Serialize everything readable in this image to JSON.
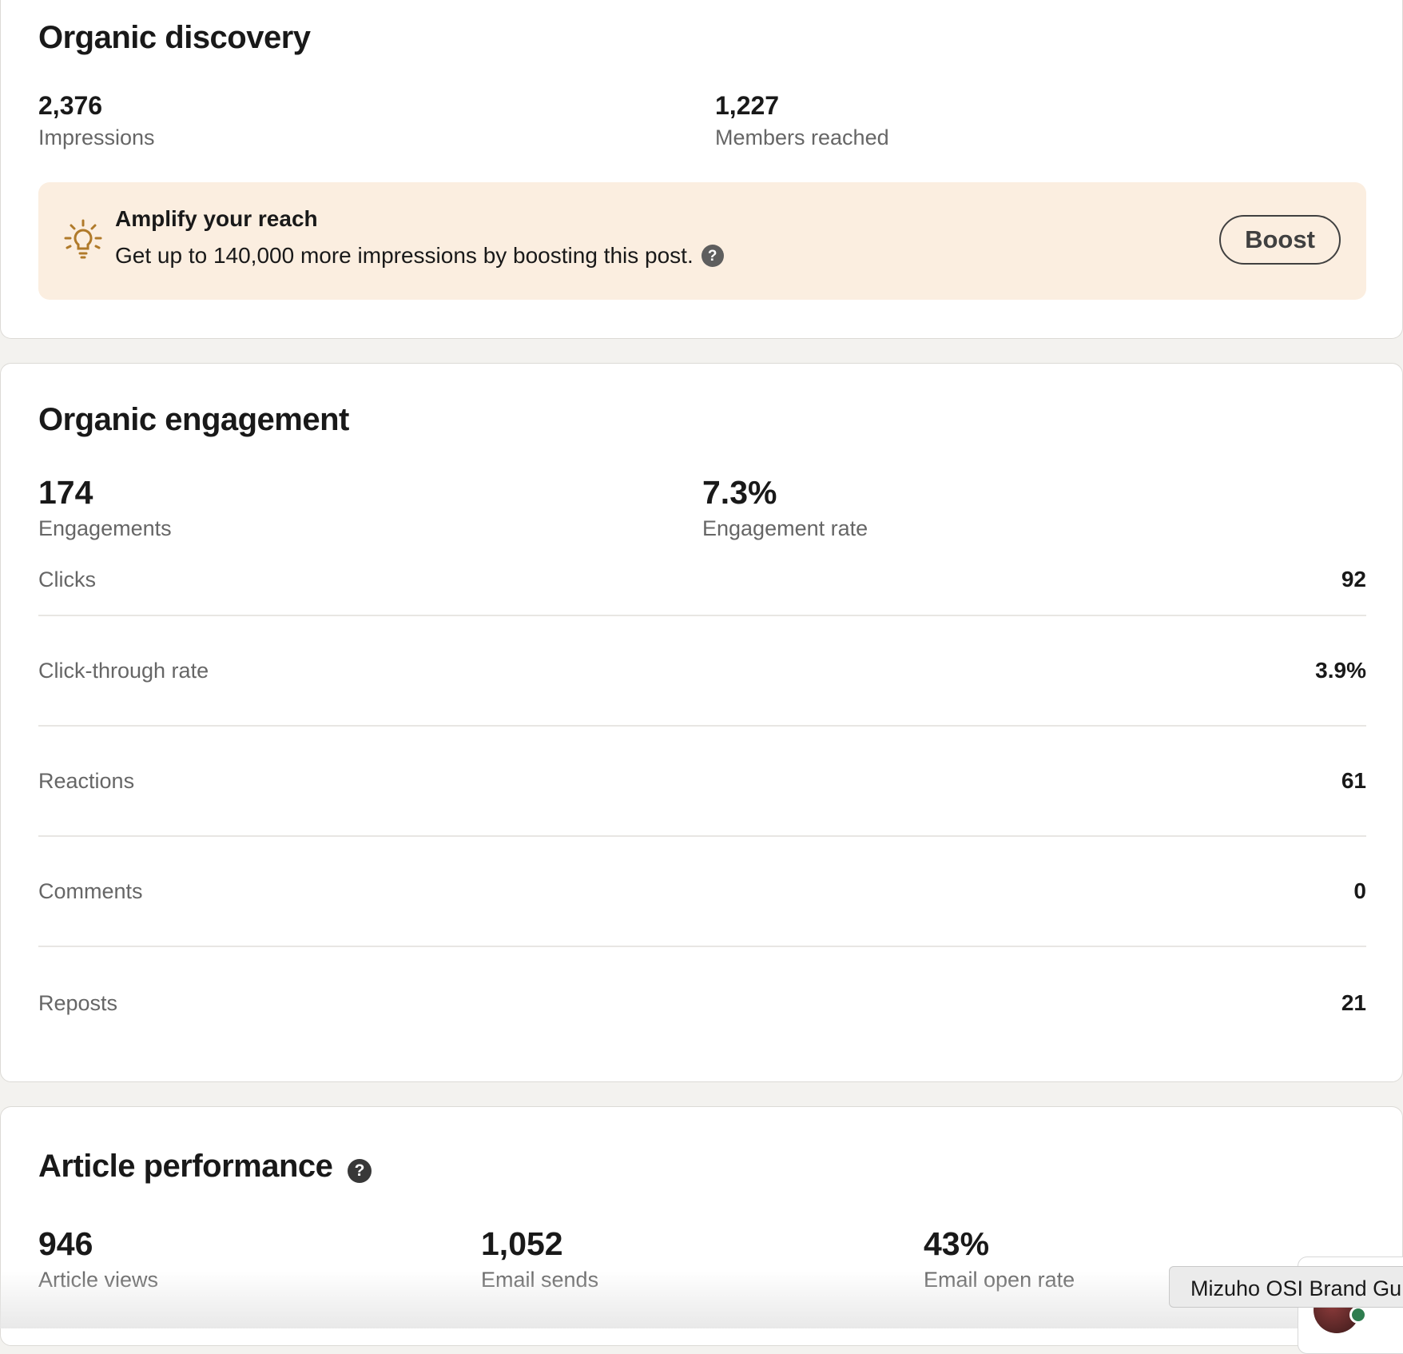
{
  "discovery": {
    "title": "Organic discovery",
    "impressions": {
      "value": "2,376",
      "label": "Impressions"
    },
    "members_reached": {
      "value": "1,227",
      "label": "Members reached"
    },
    "amplify": {
      "title": "Amplify your reach",
      "description": "Get up to 140,000 more impressions by boosting this post.",
      "boost_label": "Boost",
      "bulb_color": "#b07a2a",
      "background_color": "#fbeee0"
    }
  },
  "engagement": {
    "title": "Organic engagement",
    "engagements": {
      "value": "174",
      "label": "Engagements"
    },
    "engagement_rate": {
      "value": "7.3%",
      "label": "Engagement rate"
    },
    "rows": [
      {
        "label": "Clicks",
        "value": "92"
      },
      {
        "label": "Click-through rate",
        "value": "3.9%"
      },
      {
        "label": "Reactions",
        "value": "61"
      },
      {
        "label": "Comments",
        "value": "0"
      },
      {
        "label": "Reposts",
        "value": "21"
      }
    ]
  },
  "article": {
    "title": "Article performance",
    "article_views": {
      "value": "946",
      "label": "Article views"
    },
    "email_sends": {
      "value": "1,052",
      "label": "Email sends"
    },
    "email_open_rate": {
      "value": "43%",
      "label": "Email open rate"
    }
  },
  "messaging": {
    "tooltip_text": "Mizuho OSI Brand Gu",
    "presence_color": "#2e7d4f"
  },
  "icons": {
    "help": "?",
    "lightbulb": "lightbulb-icon"
  }
}
